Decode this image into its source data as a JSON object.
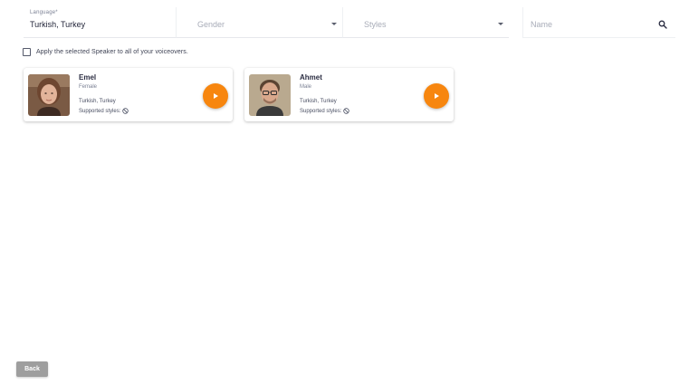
{
  "filters": {
    "language": {
      "label": "Language*",
      "value": "Turkish, Turkey"
    },
    "gender": {
      "placeholder": "Gender"
    },
    "styles": {
      "placeholder": "Styles"
    },
    "name": {
      "placeholder": "Name"
    }
  },
  "apply_checkbox": {
    "label": "Apply the selected Speaker to all of your voiceovers.",
    "checked": false
  },
  "speakers": [
    {
      "name": "Emel",
      "gender": "Female",
      "language": "Turkish, Turkey",
      "styles_label": "Supported styles:"
    },
    {
      "name": "Ahmet",
      "gender": "Male",
      "language": "Turkish, Turkey",
      "styles_label": "Supported styles:"
    }
  ],
  "back_label": "Back",
  "colors": {
    "accent": "#f7860f",
    "back_button": "#9e9e9e"
  },
  "icons": {
    "search": "search-icon",
    "dropdown": "caret-down-icon",
    "play": "play-icon",
    "no_styles": "ban-icon"
  }
}
